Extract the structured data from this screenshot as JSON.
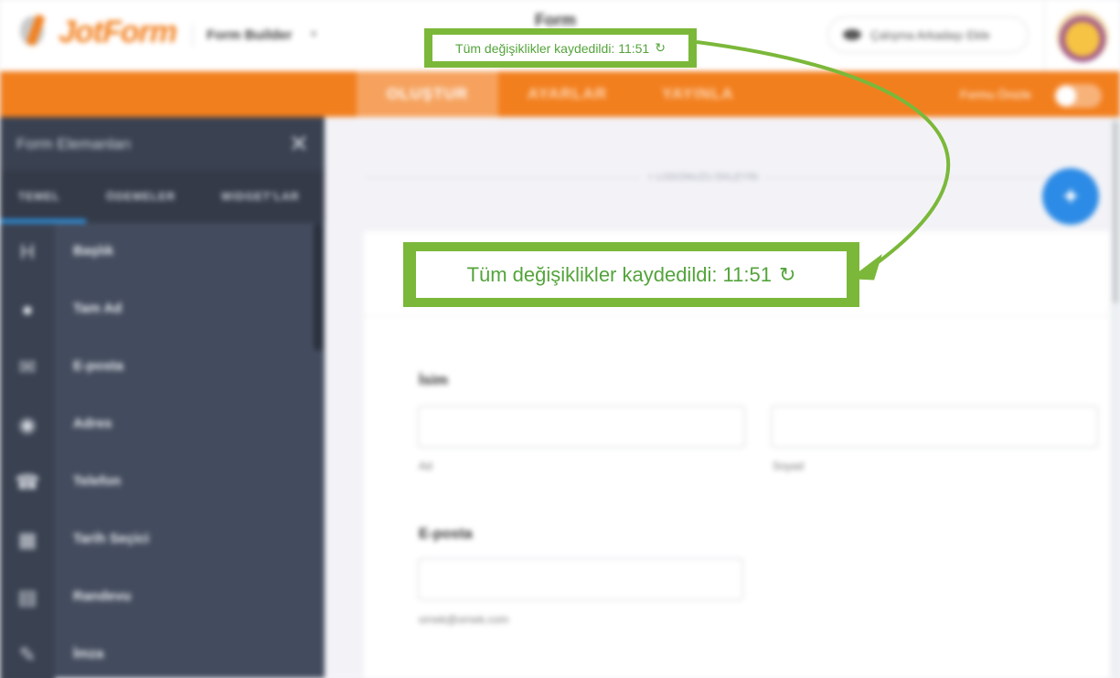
{
  "header": {
    "logo_text": "JotForm",
    "builder_label": "Form Builder",
    "form_title": "Form",
    "collab_button": "Çalışma Arkadaşı Ekle"
  },
  "orange_bar": {
    "tabs": [
      "OLUŞTUR",
      "AYARLAR",
      "YAYINLA"
    ],
    "preview_label": "Formu Önizle"
  },
  "sidebar": {
    "title": "Form Elemanları",
    "tabs": [
      "TEMEL",
      "ÖDEMELER",
      "WIDGET'LAR"
    ],
    "items": [
      {
        "label": "Başlık",
        "icon": "heading-icon"
      },
      {
        "label": "Tam Ad",
        "icon": "user-icon"
      },
      {
        "label": "E-posta",
        "icon": "envelope-icon"
      },
      {
        "label": "Adres",
        "icon": "location-icon"
      },
      {
        "label": "Telefon",
        "icon": "phone-icon"
      },
      {
        "label": "Tarih Seçici",
        "icon": "calendar-icon"
      },
      {
        "label": "Randevu",
        "icon": "appointment-icon"
      },
      {
        "label": "İmza",
        "icon": "signature-icon"
      }
    ]
  },
  "canvas": {
    "page_break_label": "+ LOGONUZU EKLEYİN",
    "fields": {
      "name_label": "İsim",
      "first_sub": "Ad",
      "last_sub": "Soyad",
      "email_label": "E-posta",
      "email_sub": "ornek@ornek.com"
    }
  },
  "annotation": {
    "save_status": "Tüm değişiklikler kaydedildi: 11:51",
    "accent_color": "#7bb83a",
    "text_color": "#53a43b"
  }
}
